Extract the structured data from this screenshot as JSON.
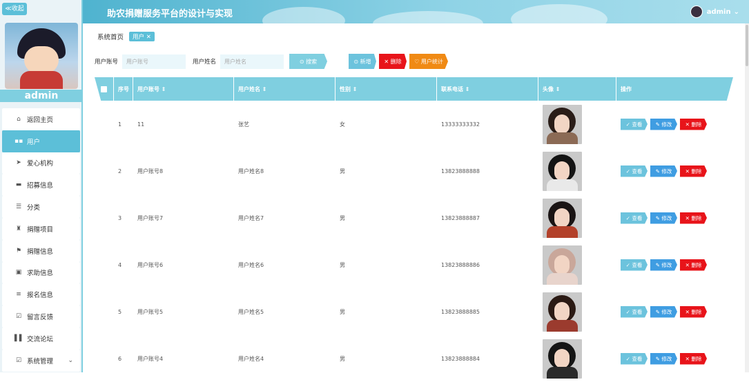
{
  "sidebar": {
    "collapse_label": "≪收起",
    "username": "admin",
    "items": [
      {
        "icon": "home-icon",
        "glyph": "⌂",
        "label": "返回主页"
      },
      {
        "icon": "grid-icon",
        "glyph": "▪▪",
        "label": "用户"
      },
      {
        "icon": "send-icon",
        "glyph": "➤",
        "label": "爱心机构"
      },
      {
        "icon": "card-icon",
        "glyph": "▬",
        "label": "招募信息"
      },
      {
        "icon": "sliders-icon",
        "glyph": "☰",
        "label": "分类"
      },
      {
        "icon": "trophy-icon",
        "glyph": "♜",
        "label": "捐赠项目"
      },
      {
        "icon": "flag-icon",
        "glyph": "⚑",
        "label": "捐赠信息"
      },
      {
        "icon": "clipboard-icon",
        "glyph": "▣",
        "label": "求助信息"
      },
      {
        "icon": "list-icon",
        "glyph": "≡",
        "label": "报名信息"
      },
      {
        "icon": "check-square-icon",
        "glyph": "☑",
        "label": "留言反馈"
      },
      {
        "icon": "bar-chart-icon",
        "glyph": "▌▌",
        "label": "交流论坛"
      },
      {
        "icon": "settings-check-icon",
        "glyph": "☑",
        "label": "系统管理",
        "chevron": "⌄"
      }
    ]
  },
  "header": {
    "title": "助农捐赠服务平台的设计与实现",
    "user": "admin",
    "user_chevron": "⌄"
  },
  "breadcrumb": {
    "home": "系统首页",
    "current": "用户 ✕"
  },
  "search": {
    "account_label": "用户账号",
    "account_placeholder": "用户账号",
    "name_label": "用户姓名",
    "name_placeholder": "用户姓名",
    "search_button": "⊙ 搜索",
    "add_button": "⊙ 新增",
    "delete_button": "✕ 删除",
    "stats_button": "♡ 用户统计"
  },
  "table": {
    "headers": [
      "序号",
      "用户账号 ⇕",
      "用户姓名 ⇕",
      "性别 ⇕",
      "联系电话 ⇕",
      "头像 ⇕",
      "操作"
    ],
    "rows": [
      {
        "no": "1",
        "account": "11",
        "name": "张艺",
        "gender": "女",
        "phone": "13333333332",
        "hair": "#2a1d18",
        "body": "#8b6a55"
      },
      {
        "no": "2",
        "account": "用户账号8",
        "name": "用户姓名8",
        "gender": "男",
        "phone": "13823888888",
        "hair": "#141414",
        "body": "#e9e9e9"
      },
      {
        "no": "3",
        "account": "用户账号7",
        "name": "用户姓名7",
        "gender": "男",
        "phone": "13823888887",
        "hair": "#1a1414",
        "body": "#b3412a"
      },
      {
        "no": "4",
        "account": "用户账号6",
        "name": "用户姓名6",
        "gender": "男",
        "phone": "13823888886",
        "hair": "#c9a79a",
        "body": "#e8d4cc"
      },
      {
        "no": "5",
        "account": "用户账号5",
        "name": "用户姓名5",
        "gender": "男",
        "phone": "13823888885",
        "hair": "#2b1a14",
        "body": "#9b3b2e"
      },
      {
        "no": "6",
        "account": "用户账号4",
        "name": "用户姓名4",
        "gender": "男",
        "phone": "13823888884",
        "hair": "#151515",
        "body": "#2a2a2a"
      }
    ],
    "actions": {
      "view": "✓ 查看",
      "edit": "✎ 修改",
      "delete": "✕ 删除"
    }
  },
  "colors": {
    "accent": "#5cbfd8",
    "header_row": "#7fcfe0",
    "view": "#6cc3dd",
    "edit": "#3f9de2",
    "delete": "#e8141a",
    "stats": "#f08a14",
    "search_btn": "#7fcfe0"
  }
}
